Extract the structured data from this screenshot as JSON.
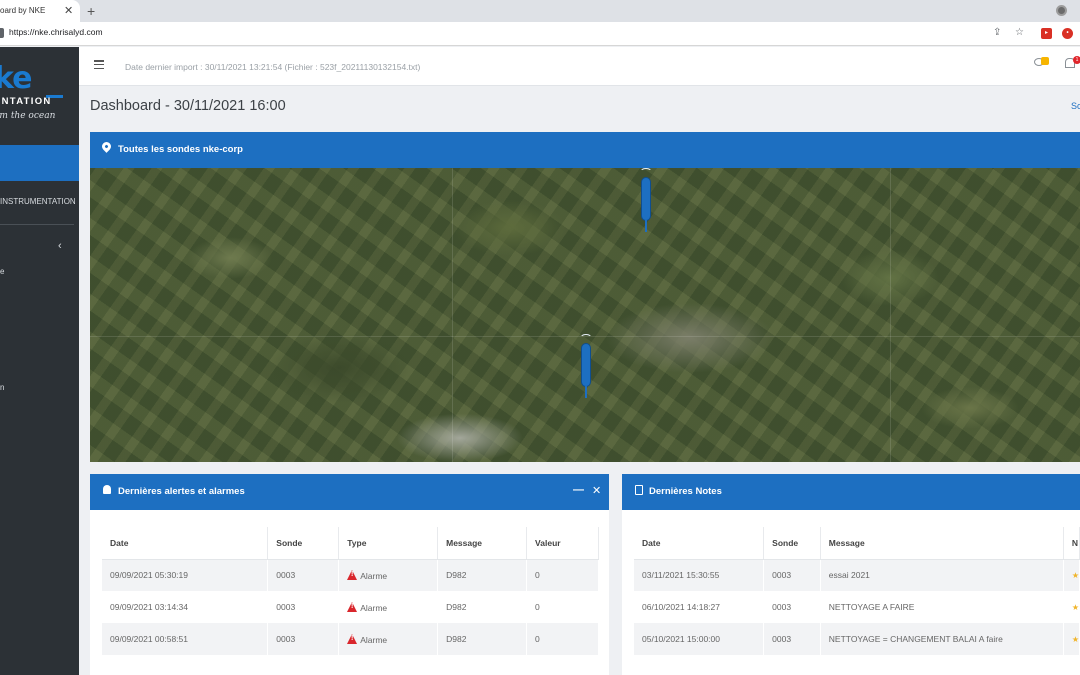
{
  "browser": {
    "tab_title": "oard by NKE",
    "tab_close": "✕",
    "new_tab": "+",
    "url": "https://nke.chrisalyd.com"
  },
  "sidebar": {
    "logo_main": "ke",
    "logo_sub": "ENTATION",
    "logo_tagline": "om the ocean",
    "org_name": "INSTRUMENTATION",
    "chevron": "‹",
    "fragments": [
      "e",
      "n"
    ]
  },
  "topbar": {
    "import_info": "Date dernier import : 30/11/2021 13:21:54 (Fichier : 523f_20211130132154.txt)",
    "bell_count": "1"
  },
  "page": {
    "title": "Dashboard - 30/11/2021 16:00",
    "right_link": "Sc"
  },
  "map_panel": {
    "title": "Toutes les sondes nke-corp"
  },
  "alerts_panel": {
    "title": "Dernières alertes et alarmes",
    "minimize": "—",
    "close": "✕",
    "columns": [
      "Date",
      "Sonde",
      "Type",
      "Message",
      "Valeur"
    ],
    "rows": [
      {
        "date": "09/09/2021 05:30:19",
        "sonde": "0003",
        "type": "Alarme",
        "message": "D982",
        "valeur": "0"
      },
      {
        "date": "09/09/2021 03:14:34",
        "sonde": "0003",
        "type": "Alarme",
        "message": "D982",
        "valeur": "0"
      },
      {
        "date": "09/09/2021 00:58:51",
        "sonde": "0003",
        "type": "Alarme",
        "message": "D982",
        "valeur": "0"
      }
    ]
  },
  "notes_panel": {
    "title": "Dernières Notes",
    "columns": [
      "Date",
      "Sonde",
      "Message",
      "N"
    ],
    "rows": [
      {
        "date": "03/11/2021 15:30:55",
        "sonde": "0003",
        "message": "essai 2021"
      },
      {
        "date": "06/10/2021 14:18:27",
        "sonde": "0003",
        "message": "NETTOYAGE A FAIRE"
      },
      {
        "date": "05/10/2021 15:00:00",
        "sonde": "0003",
        "message": "NETTOYAGE = CHANGEMENT BALAI A faire"
      }
    ]
  },
  "colors": {
    "primary": "#1d6fc1",
    "sidebar_bg": "#2c3136",
    "alarm_red": "#d9262c",
    "badge_yellow": "#f7b500"
  }
}
